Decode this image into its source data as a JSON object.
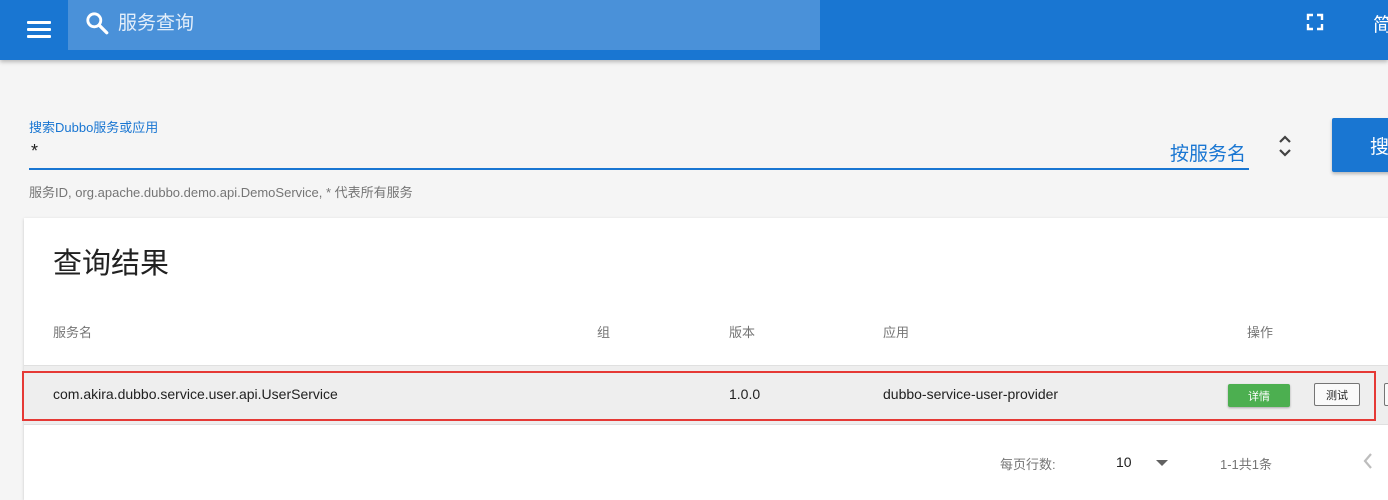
{
  "appbar": {
    "search_placeholder": "服务查询",
    "language": "简"
  },
  "search": {
    "label": "搜索Dubbo服务或应用",
    "value": "*",
    "search_by": "按服务名",
    "button_label": "搜",
    "hint": "服务ID, org.apache.dubbo.demo.api.DemoService, * 代表所有服务"
  },
  "results": {
    "title": "查询结果",
    "headers": {
      "service": "服务名",
      "group": "组",
      "version": "版本",
      "app": "应用",
      "actions": "操作"
    },
    "rows": [
      {
        "service": "com.akira.dubbo.service.user.api.UserService",
        "group": "",
        "version": "1.0.0",
        "app": "dubbo-service-user-provider",
        "detail_label": "详情",
        "test_label": "测试"
      }
    ],
    "pagination": {
      "rows_per_page_label": "每页行数:",
      "rows_per_page": "10",
      "range": "1-1共1条"
    }
  },
  "icons": {
    "menu": "menu-icon",
    "search": "search-icon",
    "fullscreen": "fullscreen-icon",
    "sort": "unfold-icon",
    "dropdown": "caret-down-icon",
    "prev": "chevron-left-icon"
  },
  "colors": {
    "primary": "#1976d2",
    "success": "#4caf50",
    "highlight": "#e53935"
  }
}
